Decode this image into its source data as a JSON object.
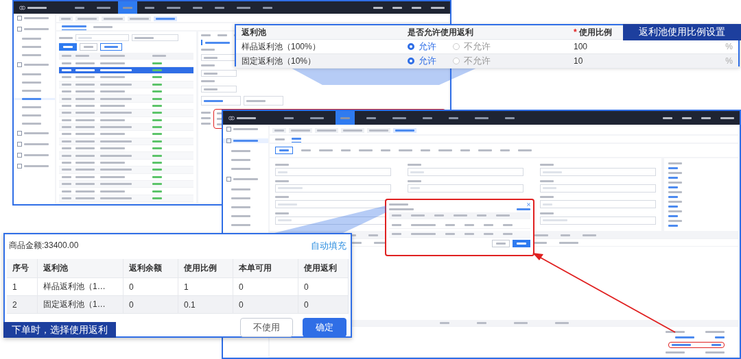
{
  "rebate_ratio_callout": {
    "label": "返利池使用比例设置",
    "columns": [
      {
        "title": "返利池",
        "required": false
      },
      {
        "title": "是否允许使用返利",
        "required": false
      },
      {
        "title": "使用比例",
        "required": true
      }
    ],
    "required_mark": "*",
    "rows": [
      {
        "pool": "样品返利池（100%）",
        "options": [
          {
            "label": "允许",
            "selected": true
          },
          {
            "label": "不允许",
            "selected": false
          }
        ],
        "ratio": "100",
        "unit": "%"
      },
      {
        "pool": "固定返利池（10%）",
        "options": [
          {
            "label": "允许",
            "selected": true
          },
          {
            "label": "不允许",
            "selected": false
          }
        ],
        "ratio": "10",
        "unit": "%"
      }
    ]
  },
  "use_rebate_callout": {
    "label": "下单时，选择使用返利",
    "amount": "商品金额:33400.00",
    "auto_fill": "自动填充",
    "columns": [
      "序号",
      "返利池",
      "返利余额",
      "使用比例",
      "本单可用",
      "使用返利"
    ],
    "rows": [
      [
        "1",
        "样品返利池（1…",
        "0",
        "1",
        "0",
        "0"
      ],
      [
        "2",
        "固定返利池（1…",
        "0",
        "0.1",
        "0",
        "0"
      ]
    ],
    "buttons": [
      {
        "label": "不使用",
        "kind": "secondary"
      },
      {
        "label": "确定",
        "kind": "primary"
      }
    ]
  }
}
